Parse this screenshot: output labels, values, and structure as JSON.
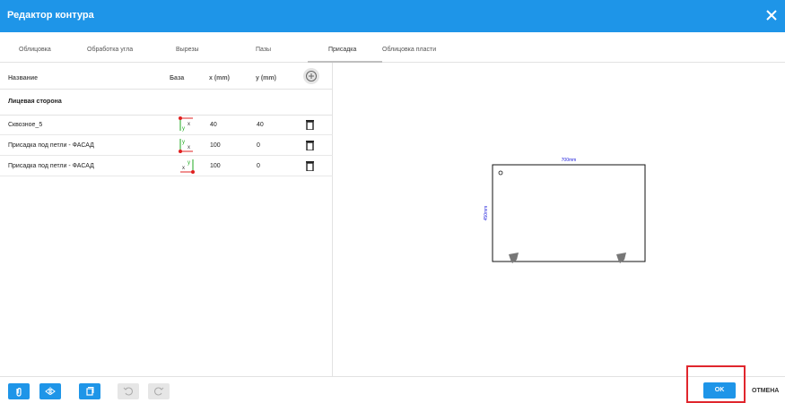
{
  "window": {
    "title": "Редактор контура"
  },
  "tabs": [
    {
      "label": "Облицовка"
    },
    {
      "label": "Обработка угла"
    },
    {
      "label": "Вырезы"
    },
    {
      "label": "Пазы"
    },
    {
      "label": "Присадка",
      "active": true
    },
    {
      "label": "Облицовка пласти"
    }
  ],
  "table": {
    "headers": {
      "name": "Название",
      "base": "База",
      "x": "x (mm)",
      "y": "y (mm)"
    },
    "group": "Лицевая сторона",
    "rows": [
      {
        "name": "Сквозное_5",
        "x": "40",
        "y": "40",
        "base_corner": "top-left"
      },
      {
        "name": "Присадка под петли - ФАСАД",
        "x": "100",
        "y": "0",
        "base_corner": "bottom-left"
      },
      {
        "name": "Присадка под петли - ФАСАД",
        "x": "100",
        "y": "0",
        "base_corner": "bottom-right"
      }
    ]
  },
  "preview": {
    "width_label": "700mm",
    "height_label": "450mm"
  },
  "footer": {
    "ok_label": "OK",
    "cancel_label": "ОТМЕНА"
  },
  "icons": {
    "close": "close-icon",
    "add": "plus-circle-icon",
    "delete": "trash-icon",
    "toolbar": [
      "paperclip-icon",
      "mirror-icon",
      "copy-icon",
      "rotate-left-icon",
      "rotate-right-icon"
    ]
  },
  "colors": {
    "accent": "#1e95e8",
    "highlight": "#e0262d",
    "marker_red": "#e02020",
    "marker_green": "#22aa22",
    "preview_label": "#1a1adb"
  }
}
